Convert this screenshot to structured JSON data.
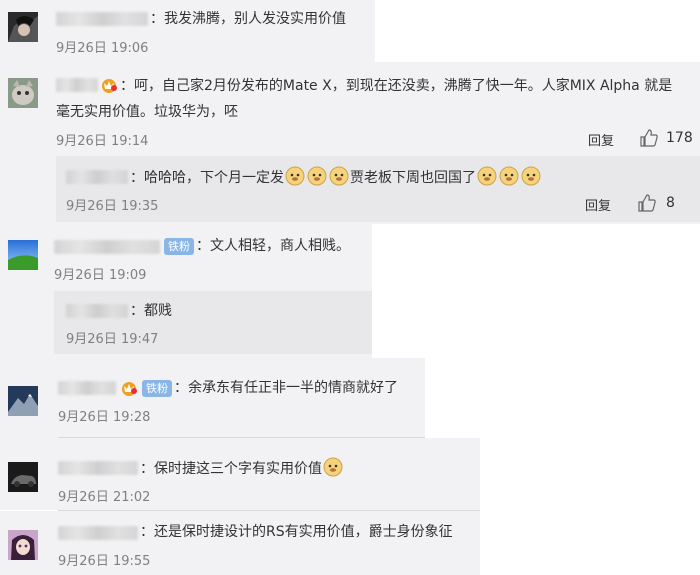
{
  "comments": [
    {
      "text": "：我发沸腾，别人发没实用价值",
      "date": "9月26日 19:06",
      "avatar_icon": "avatar-black-hair"
    },
    {
      "text_line1": "：呵，自己家2月份发布的Mate X，到现在还没卖，沸腾了快一年。人家MIX Alpha 就是",
      "text_line2": "毫无实用价值。垃圾华为，呸",
      "date": "9月26日 19:14",
      "reply_label": "回复",
      "likes": "178",
      "avatar_icon": "avatar-cat"
    },
    {
      "text": "：文人相轻，商人相贱。",
      "date": "9月26日 19:09",
      "badge": "铁粉",
      "avatar_icon": "avatar-landscape"
    },
    {
      "text": "：余承东有任正非一半的情商就好了",
      "date": "9月26日 19:28",
      "badge": "铁粉",
      "avatar_icon": "avatar-mountain"
    },
    {
      "text": "：保时捷这三个字有实用价值",
      "date": "9月26日 21:02",
      "avatar_icon": "avatar-car"
    },
    {
      "text": "：还是保时捷设计的RS有实用价值，爵士身份象征",
      "date": "9月26日 19:55",
      "avatar_icon": "avatar-girl"
    }
  ],
  "replies": [
    {
      "text_a": "：哈哈哈，下个月一定发",
      "text_b": "贾老板下周也回国了",
      "date": "9月26日 19:35",
      "reply_label": "回复",
      "likes": "8"
    },
    {
      "text": "：都贱",
      "date": "9月26日 19:47"
    }
  ],
  "colors": {
    "panel": "#f2f2f5",
    "sub": "#e8e8ea",
    "date": "#808080",
    "badge": "#8ab6e6"
  }
}
